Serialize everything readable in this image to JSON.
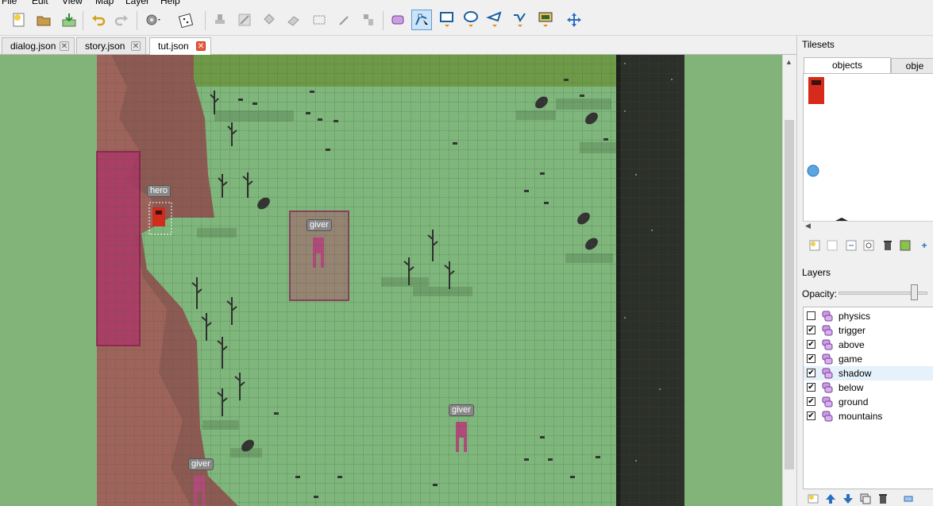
{
  "menu": [
    "File",
    "Edit",
    "View",
    "Map",
    "Layer",
    "Help"
  ],
  "toolbar": {
    "icons": [
      "new-map",
      "open",
      "save",
      "undo",
      "redo",
      "commands",
      "random",
      "stamp-brush",
      "terrain-brush",
      "bucket-fill",
      "eraser",
      "rect-select",
      "magic-wand",
      "select-same",
      "select-objects",
      "edit-polygons",
      "insert-rectangle",
      "insert-ellipse",
      "insert-polygon",
      "insert-polyline",
      "insert-tile",
      "move"
    ]
  },
  "tabs": [
    {
      "label": "dialog.json",
      "active": false
    },
    {
      "label": "story.json",
      "active": false
    },
    {
      "label": "tut.json",
      "active": true
    }
  ],
  "tilesets": {
    "title": "Tilesets",
    "tabs": [
      "objects",
      "obje"
    ]
  },
  "layers": {
    "title": "Layers",
    "opacity_label": "Opacity:",
    "items": [
      {
        "name": "physics",
        "checked": false
      },
      {
        "name": "trigger",
        "checked": true
      },
      {
        "name": "above",
        "checked": true
      },
      {
        "name": "game",
        "checked": true
      },
      {
        "name": "shadow",
        "checked": true,
        "selected": true
      },
      {
        "name": "below",
        "checked": true
      },
      {
        "name": "ground",
        "checked": true
      },
      {
        "name": "mountains",
        "checked": true
      }
    ]
  },
  "map_labels": {
    "hero": "hero",
    "giver1": "giver",
    "giver2": "giver",
    "giver3": "giver"
  },
  "colors": {
    "grass": "#82b47a",
    "cliff": "#8c5a52",
    "dark_strip": "#2c2f2a",
    "trigger_fill": "#b0306a",
    "selection": "#cce4f7"
  }
}
